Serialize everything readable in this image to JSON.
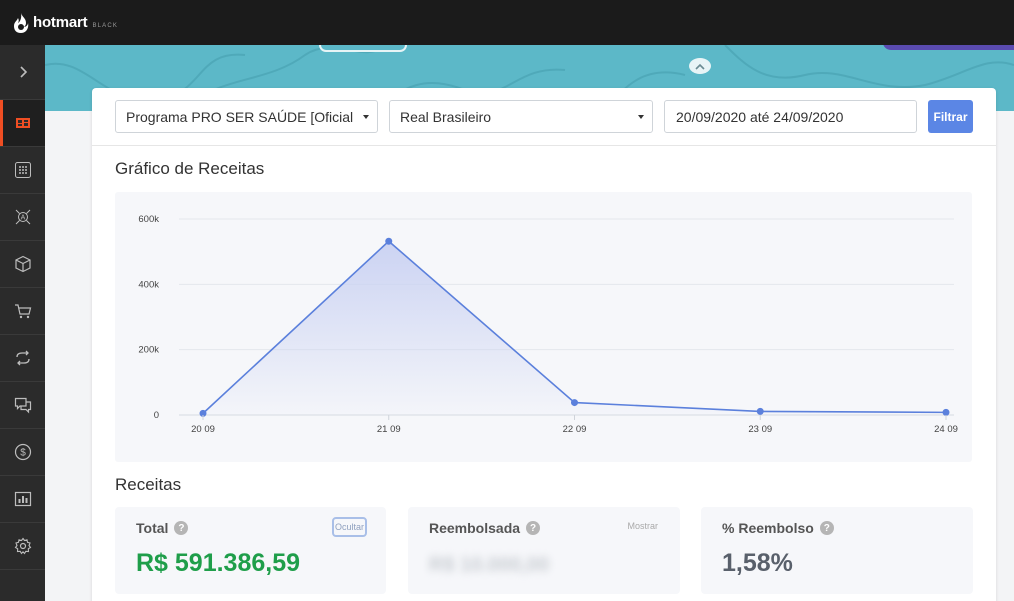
{
  "app": {
    "logo_text": "hotmart",
    "logo_sub": "BLACK"
  },
  "sidebar": {
    "items": [
      {
        "icon": "chevron-right-icon",
        "active": false
      },
      {
        "icon": "dashboard-icon",
        "active": true
      },
      {
        "icon": "apps-grid-icon",
        "active": false
      },
      {
        "icon": "affiliates-network-icon",
        "active": false
      },
      {
        "icon": "product-box-icon",
        "active": false
      },
      {
        "icon": "cart-icon",
        "active": false
      },
      {
        "icon": "recurrence-icon",
        "active": false
      },
      {
        "icon": "messages-icon",
        "active": false
      },
      {
        "icon": "money-icon",
        "active": false
      },
      {
        "icon": "reports-chart-icon",
        "active": false
      },
      {
        "icon": "settings-gear-icon",
        "active": false
      }
    ]
  },
  "filters": {
    "program": "Programa PRO SER SAÚDE [Oficial",
    "currency": "Real Brasileiro",
    "date_range": "20/09/2020 até 24/09/2020",
    "filter_button": "Filtrar"
  },
  "chart_section": {
    "title": "Gráfico de Receitas"
  },
  "chart_data": {
    "type": "area",
    "title": "",
    "xlabel": "",
    "ylabel": "",
    "categories": [
      "20 09",
      "21 09",
      "22 09",
      "23 09",
      "24 09"
    ],
    "series": [
      {
        "values": [
          5000,
          532000,
          38000,
          11000,
          8000
        ]
      }
    ],
    "ylim": [
      0,
      600000
    ],
    "yticks": [
      0,
      200000,
      400000,
      600000
    ],
    "ytick_labels": [
      "0",
      "200k",
      "400k",
      "600k"
    ],
    "grid": true,
    "colors": {
      "line": "#5b80dc",
      "fill": "#c9d1f2"
    }
  },
  "revenue_section": {
    "title": "Receitas",
    "cards": [
      {
        "label": "Total",
        "action": "Ocultar",
        "value": "R$ 591.386,59"
      },
      {
        "label": "Reembolsada",
        "action": "Mostrar",
        "value": "R$ 10.000,00"
      },
      {
        "label": "% Reembolso",
        "value": "1,58%"
      }
    ]
  },
  "colors": {
    "accent": "#5b86e5",
    "brand_orange": "#ef4e23",
    "positive": "#1f9e4a",
    "banner": "#5cb8c8"
  }
}
